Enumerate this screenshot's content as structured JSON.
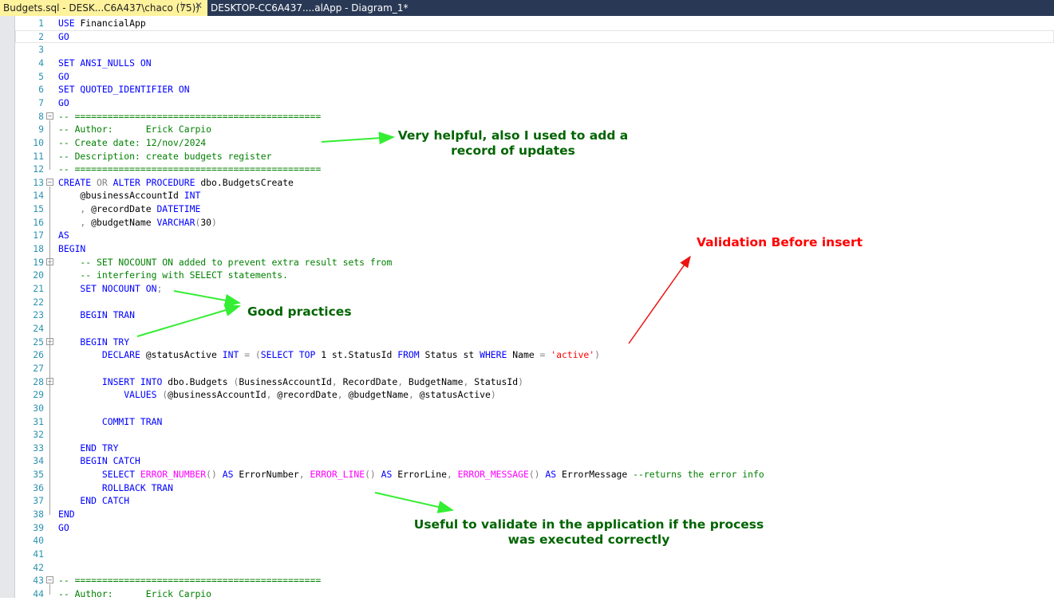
{
  "tabs": {
    "active": {
      "label": "Budgets.sql - DESK...C6A437\\chaco (75))",
      "pin_icon": "pin-icon",
      "close_icon": "close-icon"
    },
    "inactive": {
      "label": "DESKTOP-CC6A437....alApp - Diagram_1*"
    }
  },
  "colors": {
    "keyword": "#0000ff",
    "comment": "#008000",
    "operator": "#808080",
    "function": "#ff00ff",
    "string": "#ff0000",
    "note_green": "#006400",
    "arrow_green": "#33ee33",
    "note_red": "#ff0000"
  },
  "lines": [
    [
      [
        "kw",
        "USE "
      ],
      [
        "tx",
        "FinancialApp"
      ]
    ],
    [
      [
        "kw",
        "GO"
      ]
    ],
    [],
    [
      [
        "kw",
        "SET ANSI_NULLS ON"
      ]
    ],
    [
      [
        "kw",
        "GO"
      ]
    ],
    [
      [
        "kw",
        "SET QUOTED_IDENTIFIER ON"
      ]
    ],
    [
      [
        "kw",
        "GO"
      ]
    ],
    [
      [
        "cm",
        "-- ============================================="
      ]
    ],
    [
      [
        "cm",
        "-- Author:      Erick Carpio"
      ]
    ],
    [
      [
        "cm",
        "-- Create date: 12/nov/2024"
      ]
    ],
    [
      [
        "cm",
        "-- Description: create budgets register"
      ]
    ],
    [
      [
        "cm",
        "-- ============================================="
      ]
    ],
    [
      [
        "kw",
        "CREATE "
      ],
      [
        "op",
        "OR "
      ],
      [
        "kw",
        "ALTER PROCEDURE "
      ],
      [
        "tx",
        "dbo.BudgetsCreate"
      ]
    ],
    [
      [
        "tx",
        "    @businessAccountId "
      ],
      [
        "kw",
        "INT"
      ]
    ],
    [
      [
        "op",
        "    , "
      ],
      [
        "tx",
        "@recordDate "
      ],
      [
        "kw",
        "DATETIME"
      ]
    ],
    [
      [
        "op",
        "    , "
      ],
      [
        "tx",
        "@budgetName "
      ],
      [
        "kw",
        "VARCHAR"
      ],
      [
        "op",
        "("
      ],
      [
        "tx",
        "30"
      ],
      [
        "op",
        ")"
      ]
    ],
    [
      [
        "kw",
        "AS"
      ]
    ],
    [
      [
        "kw",
        "BEGIN"
      ]
    ],
    [
      [
        "cm",
        "    -- SET NOCOUNT ON added to prevent extra result sets from"
      ]
    ],
    [
      [
        "cm",
        "    -- interfering with SELECT statements."
      ]
    ],
    [
      [
        "kw",
        "    SET NOCOUNT ON"
      ],
      [
        "op",
        ";"
      ]
    ],
    [],
    [
      [
        "kw",
        "    BEGIN TRAN"
      ]
    ],
    [],
    [
      [
        "kw",
        "    BEGIN TRY"
      ]
    ],
    [
      [
        "kw",
        "        DECLARE "
      ],
      [
        "tx",
        "@statusActive "
      ],
      [
        "kw",
        "INT "
      ],
      [
        "op",
        "= ("
      ],
      [
        "kw",
        "SELECT TOP "
      ],
      [
        "tx",
        "1 st.StatusId "
      ],
      [
        "kw",
        "FROM "
      ],
      [
        "tx",
        "Status st "
      ],
      [
        "kw",
        "WHERE "
      ],
      [
        "tx",
        "Name "
      ],
      [
        "op",
        "= "
      ],
      [
        "st",
        "'active'"
      ],
      [
        "op",
        ")"
      ]
    ],
    [],
    [
      [
        "kw",
        "        INSERT INTO "
      ],
      [
        "tx",
        "dbo.Budgets "
      ],
      [
        "op",
        "("
      ],
      [
        "tx",
        "BusinessAccountId"
      ],
      [
        "op",
        ", "
      ],
      [
        "tx",
        "RecordDate"
      ],
      [
        "op",
        ", "
      ],
      [
        "tx",
        "BudgetName"
      ],
      [
        "op",
        ", "
      ],
      [
        "tx",
        "StatusId"
      ],
      [
        "op",
        ")"
      ]
    ],
    [
      [
        "kw",
        "            VALUES "
      ],
      [
        "op",
        "("
      ],
      [
        "tx",
        "@businessAccountId"
      ],
      [
        "op",
        ", "
      ],
      [
        "tx",
        "@recordDate"
      ],
      [
        "op",
        ", "
      ],
      [
        "tx",
        "@budgetName"
      ],
      [
        "op",
        ", "
      ],
      [
        "tx",
        "@statusActive"
      ],
      [
        "op",
        ")"
      ]
    ],
    [],
    [
      [
        "kw",
        "        COMMIT TRAN"
      ]
    ],
    [],
    [
      [
        "kw",
        "    END TRY"
      ]
    ],
    [
      [
        "kw",
        "    BEGIN CATCH"
      ]
    ],
    [
      [
        "kw",
        "        SELECT "
      ],
      [
        "fn",
        "ERROR_NUMBER"
      ],
      [
        "op",
        "() "
      ],
      [
        "kw",
        "AS "
      ],
      [
        "tx",
        "ErrorNumber"
      ],
      [
        "op",
        ", "
      ],
      [
        "fn",
        "ERROR_LINE"
      ],
      [
        "op",
        "() "
      ],
      [
        "kw",
        "AS "
      ],
      [
        "tx",
        "ErrorLine"
      ],
      [
        "op",
        ", "
      ],
      [
        "fn",
        "ERROR_MESSAGE"
      ],
      [
        "op",
        "() "
      ],
      [
        "kw",
        "AS "
      ],
      [
        "tx",
        "ErrorMessage "
      ],
      [
        "cm",
        "--returns the error info"
      ]
    ],
    [
      [
        "kw",
        "        ROLLBACK TRAN"
      ]
    ],
    [
      [
        "kw",
        "    END CATCH"
      ]
    ],
    [
      [
        "kw",
        "END"
      ]
    ],
    [
      [
        "kw",
        "GO"
      ]
    ],
    [],
    [],
    [],
    [
      [
        "cm",
        "-- ============================================="
      ]
    ],
    [
      [
        "cm",
        "-- Author:      Erick Carpio"
      ]
    ]
  ],
  "annotations": [
    {
      "id": "note-helpful",
      "lines": [
        "Very helpful, also I used to add a",
        "record of updates"
      ],
      "color": "green"
    },
    {
      "id": "note-good-practices",
      "lines": [
        "Good practices"
      ],
      "color": "green"
    },
    {
      "id": "note-validation",
      "lines": [
        "Validation Before insert"
      ],
      "color": "red"
    },
    {
      "id": "note-useful",
      "lines": [
        "Useful to validate in the application if the process",
        "was executed correctly"
      ],
      "color": "green"
    }
  ]
}
